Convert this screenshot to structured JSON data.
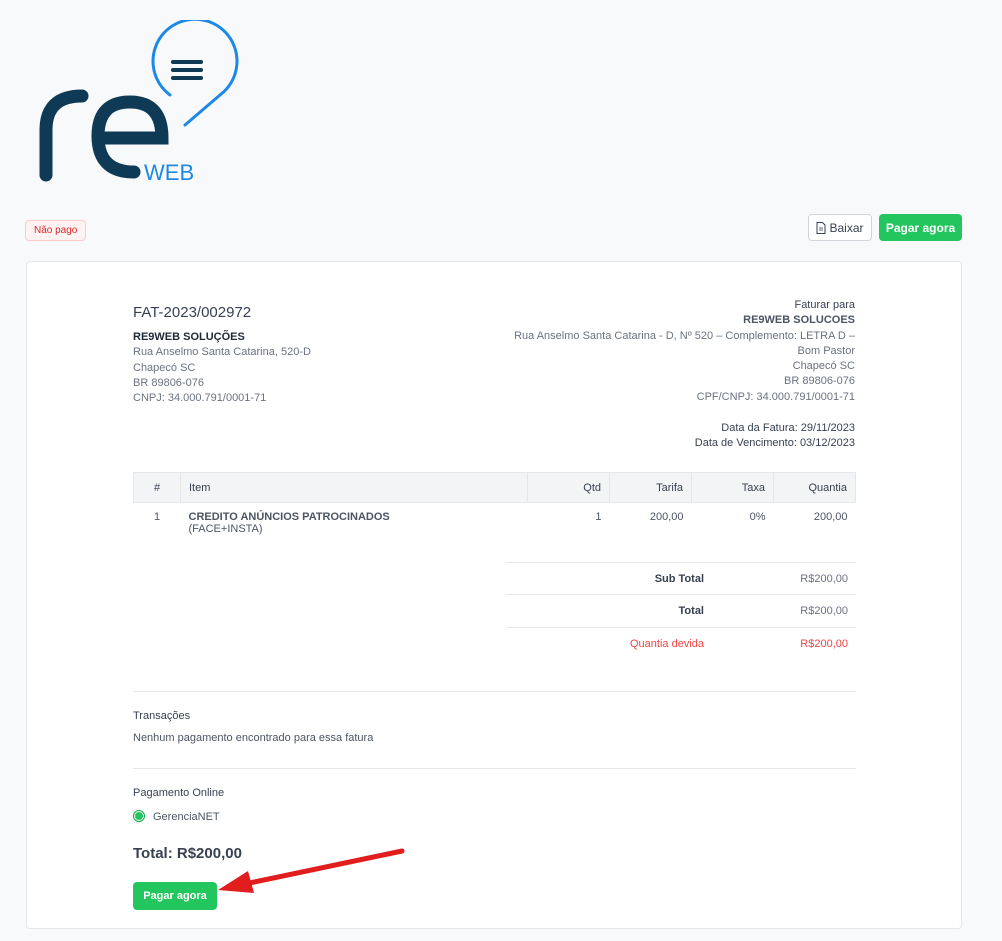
{
  "status_badge": "Não pago",
  "toolbar": {
    "download_label": "Baixar",
    "pay_label": "Pagar agora"
  },
  "brand": {
    "logo_text": "re",
    "logo_sub": "WEB"
  },
  "invoice": {
    "number": "FAT-2023/002972",
    "from": {
      "name": "RE9WEB SOLUÇÕES",
      "lines": [
        "Rua Anselmo Santa Catarina, 520-D",
        "Chapecó SC",
        "BR 89806-076",
        "CNPJ: 34.000.791/0001-71"
      ]
    },
    "to": {
      "label": "Faturar para",
      "name": "RE9WEB SOLUCOES",
      "lines": [
        "Rua Anselmo Santa Catarina - D, Nº 520 – Complemento: LETRA D –",
        "Bom Pastor",
        "Chapecó SC",
        "BR 89806-076",
        "CPF/CNPJ: 34.000.791/0001-71"
      ]
    },
    "dates": {
      "issue": "Data da Fatura: 29/11/2023",
      "due": "Data de Vencimento: 03/12/2023"
    },
    "table": {
      "headers": [
        "#",
        "Item",
        "Qtd",
        "Tarifa",
        "Taxa",
        "Quantia"
      ],
      "rows": [
        {
          "n": "1",
          "item": "CREDITO ANÚNCIOS PATROCINADOS",
          "desc": "(FACE+INSTA)",
          "qty": "1",
          "rate": "200,00",
          "tax": "0%",
          "amount": "200,00"
        }
      ]
    },
    "totals": {
      "subtotal_label": "Sub Total",
      "subtotal": "R$200,00",
      "total_label": "Total",
      "total": "R$200,00",
      "due_label": "Quantia devida",
      "due": "R$200,00"
    },
    "transactions": {
      "title": "Transações",
      "empty": "Nenhum pagamento encontrado para essa fatura"
    },
    "payment": {
      "title": "Pagamento Online",
      "method": "GerenciaNET",
      "total": "Total: R$200,00",
      "pay_label": "Pagar agora"
    }
  },
  "colors": {
    "accent_green": "#22c55e",
    "danger": "#ef4444",
    "brand_navy": "#0e3a55",
    "brand_blue": "#1e88e5",
    "arrow_red": "#e11d1d"
  }
}
